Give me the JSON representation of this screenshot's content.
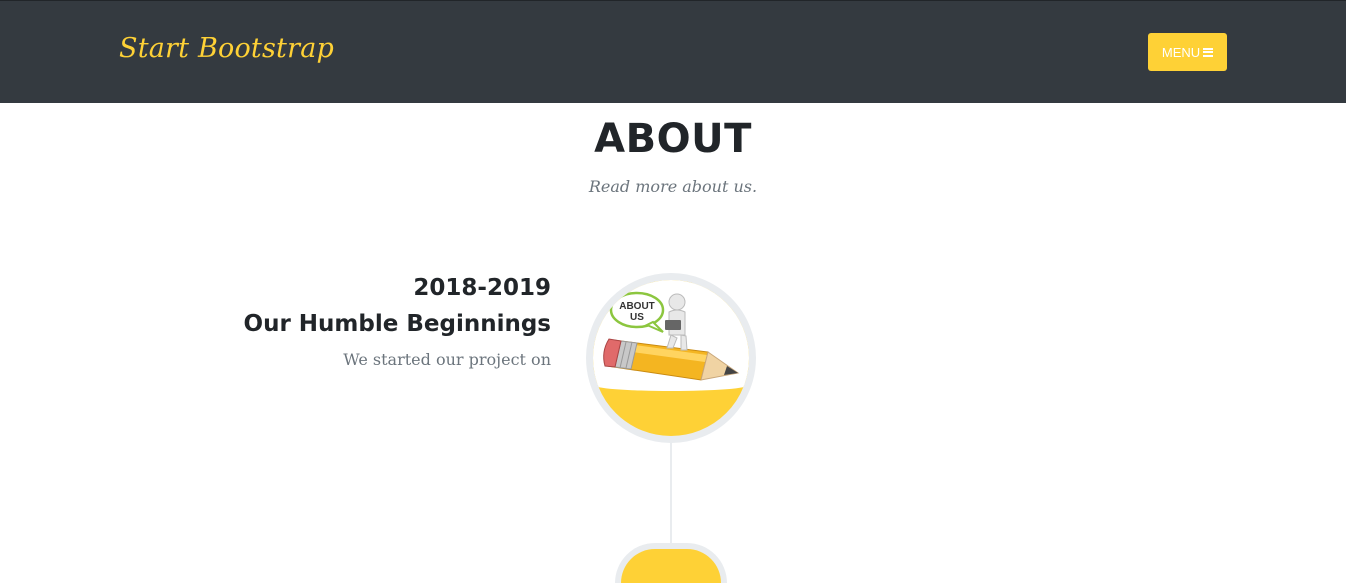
{
  "navbar": {
    "brand": "Start Bootstrap",
    "menu_label": "MENU",
    "menu_icon": "bars-icon"
  },
  "about": {
    "heading": "ABOUT",
    "subheading": "Read more about us."
  },
  "timeline": {
    "items": [
      {
        "date": "2018-2019",
        "title": "Our Humble Beginnings",
        "body": "We started our project on",
        "image_badge": "ABOUT US"
      }
    ]
  },
  "colors": {
    "navbar_bg": "#343a40",
    "accent": "#fed136",
    "heading": "#212529",
    "muted": "#6c757d"
  }
}
